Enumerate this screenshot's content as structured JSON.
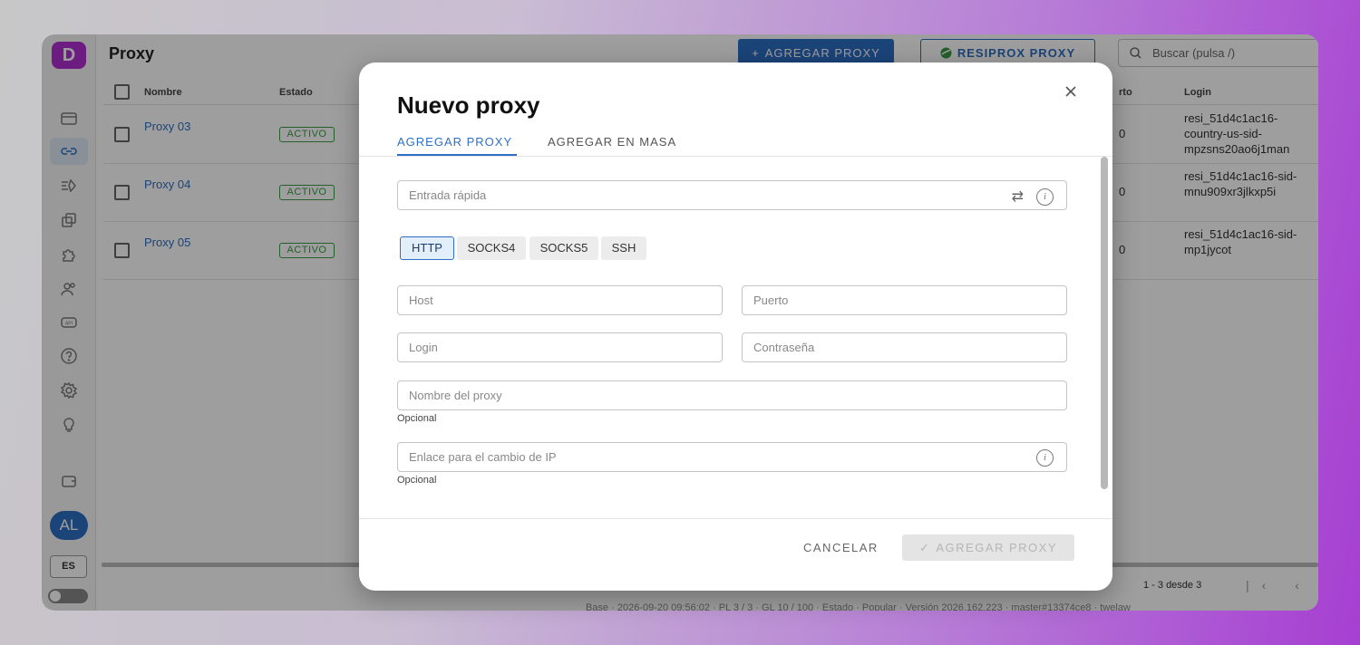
{
  "app": {
    "logo_letter": "D",
    "page_title": "Proxy"
  },
  "toolbar": {
    "add_label": "AGREGAR PROXY",
    "resi_label": "RESIPROX PROXY",
    "search_placeholder": "Buscar (pulsa /)"
  },
  "sidebar": {
    "avatar_initials": "AL",
    "language": "ES"
  },
  "table": {
    "columns": {
      "name": "Nombre",
      "status": "Estado",
      "port": "rto",
      "login": "Login"
    },
    "rows": [
      {
        "name": "Proxy 03",
        "status": "ACTIVO",
        "port": "0",
        "login": "resi_51d4c1ac16-country-us-sid-mpzsns20ao6j1man"
      },
      {
        "name": "Proxy 04",
        "status": "ACTIVO",
        "port": "0",
        "login": "resi_51d4c1ac16-sid-mnu909xr3jlkxp5i"
      },
      {
        "name": "Proxy 05",
        "status": "ACTIVO",
        "port": "0",
        "login": "resi_51d4c1ac16-sid-mp1jycot"
      }
    ],
    "pagination": "1 - 3 desde 3",
    "status_bar": "Base · 2026-09-20 09:56:02 · PL 3 / 3 · GL 10 / 100 · Estado · Popular · Versión 2026.162.223 · master#13374ce8 · twelaw"
  },
  "modal": {
    "title": "Nuevo proxy",
    "tabs": [
      "AGREGAR PROXY",
      "AGREGAR EN MASA"
    ],
    "quick_input_placeholder": "Entrada rápida",
    "protocols": [
      "HTTP",
      "SOCKS4",
      "SOCKS5",
      "SSH"
    ],
    "selected_protocol": "HTTP",
    "host_placeholder": "Host",
    "port_placeholder": "Puerto",
    "login_placeholder": "Login",
    "password_placeholder": "Contraseña",
    "name_placeholder": "Nombre del proxy",
    "name_helper": "Opcional",
    "ip_link_placeholder": "Enlace para el cambio de IP",
    "ip_link_helper": "Opcional",
    "cancel_label": "CANCELAR",
    "submit_label": "AGREGAR PROXY"
  },
  "colors": {
    "accent": "#2d6fc4",
    "brand": "#b02fd0",
    "active_status": "#3c9a47"
  }
}
